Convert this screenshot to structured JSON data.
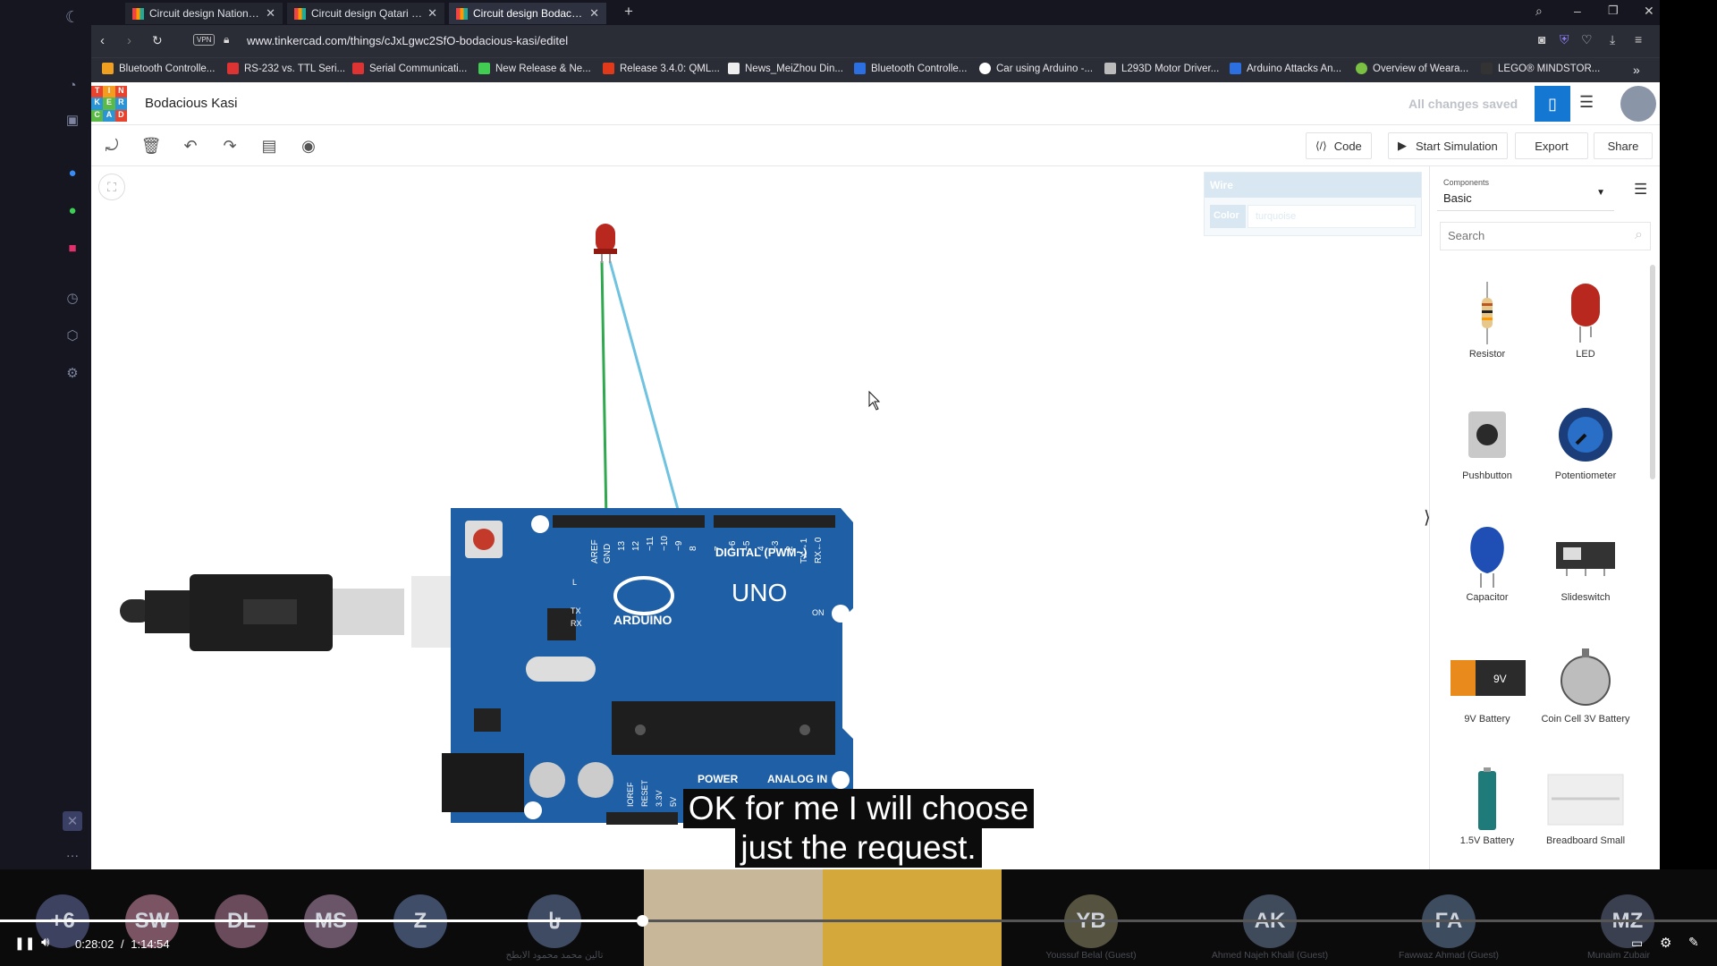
{
  "browser": {
    "tabs": [
      {
        "label": "Circuit design National Day"
      },
      {
        "label": "Circuit design Qatari flag s"
      },
      {
        "label": "Circuit design Bodacious K"
      }
    ],
    "new_tab": "+",
    "url": "www.tinkercad.com/things/cJxLgwc2SfO-bodacious-kasi/editel",
    "vpn": "VPN",
    "bookmarks": [
      "Bluetooth Controlle...",
      "RS-232 vs. TTL Seri...",
      "Serial Communicati...",
      "New Release & Ne...",
      "Release 3.4.0: QML...",
      "News_MeiZhou Din...",
      "Bluetooth Controlle...",
      "Car using Arduino -...",
      "L293D Motor Driver...",
      "Arduino Attacks An...",
      "Overview of Weara...",
      "LEGO® MINDSTOR..."
    ],
    "more": "»"
  },
  "app": {
    "logo": [
      "TIN",
      "KER",
      "CAD"
    ],
    "project_title": "Bodacious Kasi",
    "save_status": "All changes saved",
    "toolbar": {
      "code": "Code",
      "start_simulation": "Start Simulation",
      "export": "Export",
      "share": "Share"
    },
    "wire_inspector": {
      "title": "Wire",
      "color_label": "Color",
      "color_value": "turquoise"
    },
    "components": {
      "label": "Components",
      "selected": "Basic",
      "search_placeholder": "Search",
      "items": [
        {
          "name": "Resistor"
        },
        {
          "name": "LED"
        },
        {
          "name": "Pushbutton"
        },
        {
          "name": "Potentiometer"
        },
        {
          "name": "Capacitor"
        },
        {
          "name": "Slideswitch"
        },
        {
          "name": "9V Battery"
        },
        {
          "name": "Coin Cell 3V Battery"
        },
        {
          "name": "1.5V Battery"
        },
        {
          "name": "Breadboard Small"
        }
      ]
    },
    "board": {
      "uno": "UNO",
      "arduino": "ARDUINO",
      "digital": "DIGITAL (PWM~)",
      "power": "POWER",
      "analog": "ANALOG IN",
      "on": "ON",
      "tx": "TX",
      "rx": "RX",
      "l": "L",
      "aref": "AREF",
      "gnd": "GND",
      "p13": "13",
      "p12": "12",
      "p11": "~11",
      "p10": "~10",
      "p9": "~9",
      "p8": "8",
      "p7": "7",
      "p6": "~6",
      "p5": "~5",
      "p4": "4",
      "p3": "~3",
      "p2": "2",
      "tx1": "TX→1",
      "rx0": "RX←0",
      "ioref": "IOREF",
      "reset": "RESET",
      "v33": "3.3V",
      "v5": "5V",
      "battery_9v": "9V"
    }
  },
  "caption": {
    "line1": "OK for me I will choose",
    "line2": "just the request."
  },
  "player": {
    "current": "0:28:02",
    "separator": "/",
    "total": "1:14:54",
    "progress": 0.374
  },
  "participants": [
    {
      "initials": "+6",
      "name": ""
    },
    {
      "initials": "SW",
      "name": ""
    },
    {
      "initials": "DL",
      "name": ""
    },
    {
      "initials": "MS",
      "name": ""
    },
    {
      "initials": "Z",
      "name": ""
    },
    {
      "initials": "تا",
      "name": "تالين محمد محمود الابطح"
    },
    {
      "initials": "YB",
      "name": "Youssuf Belal (Guest)"
    },
    {
      "initials": "AK",
      "name": "Ahmed Najeh Khalil (Guest)"
    },
    {
      "initials": "FA",
      "name": "Fawwaz Ahmad (Guest)"
    },
    {
      "initials": "MZ",
      "name": "Munaim Zubair"
    }
  ],
  "colors": {
    "accent": "#1477d1",
    "board": "#1f5fa6",
    "wire_green": "#2fa84f",
    "wire_turquoise": "#6fc3e0",
    "led": "#b9281e"
  }
}
